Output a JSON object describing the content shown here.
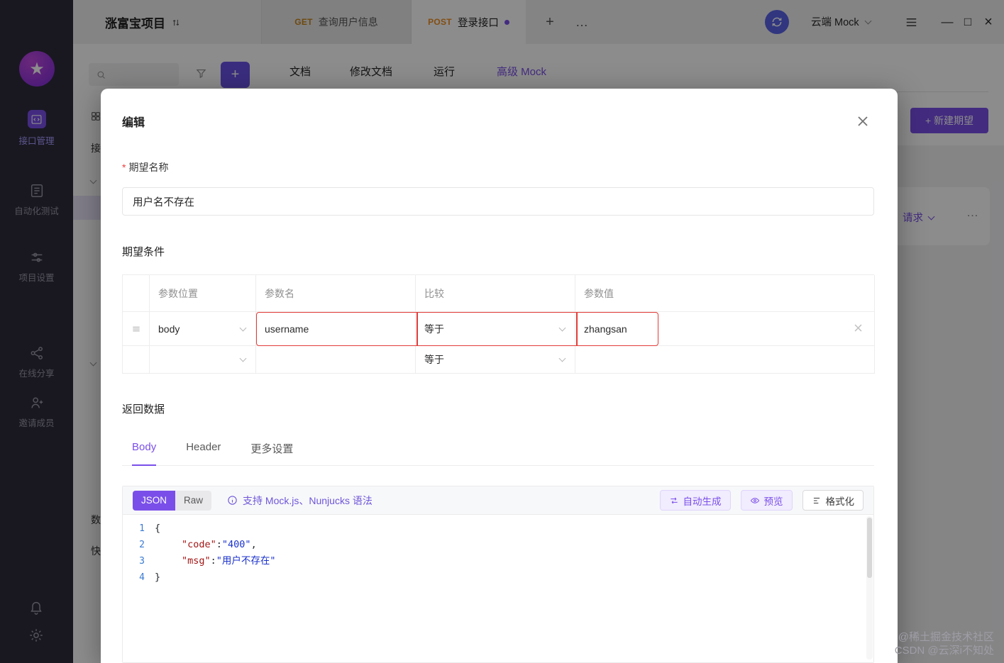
{
  "app": {
    "project_name": "涨富宝项目",
    "mock_env": "云端 Mock",
    "window_controls": {
      "minimize": "—",
      "maximize": "□",
      "close": "×"
    }
  },
  "sidebar": {
    "items": [
      {
        "label": "接口管理"
      },
      {
        "label": "自动化测试"
      },
      {
        "label": "项目设置"
      },
      {
        "label": "在线分享"
      },
      {
        "label": "邀请成员"
      }
    ]
  },
  "tabs": {
    "get_method": "GET",
    "get_label": "查询用户信息",
    "post_method": "POST",
    "post_label": "登录接口",
    "add": "+",
    "more": "…"
  },
  "toolbar": {
    "add_label": "+",
    "doc_tabs": [
      "文档",
      "修改文档",
      "运行",
      "高级 Mock"
    ]
  },
  "background": {
    "new_expectation": "+ 新建期望",
    "request": "请求",
    "more": "…",
    "tree_fragments": [
      "接",
      "数",
      "快"
    ]
  },
  "modal": {
    "title": "编辑",
    "required_mark": "*",
    "name_label": "期望名称",
    "name_value": "用户名不存在",
    "condition_title": "期望条件",
    "table": {
      "headers": [
        "参数位置",
        "参数名",
        "比较",
        "参数值"
      ],
      "row1": {
        "position": "body",
        "name": "username",
        "compare": "等于",
        "value": "zhangsan"
      },
      "row2": {
        "position": "",
        "name": "",
        "compare": "等于",
        "value": ""
      }
    },
    "return_title": "返回数据",
    "body_tabs": [
      "Body",
      "Header",
      "更多设置"
    ],
    "editor": {
      "mode_json": "JSON",
      "mode_raw": "Raw",
      "hint": "支持 Mock.js、Nunjucks 语法",
      "auto_generate": "自动生成",
      "preview": "预览",
      "format": "格式化",
      "line_numbers": [
        "1",
        "2",
        "3",
        "4"
      ],
      "code": {
        "l1": "{",
        "l2_key": "\"code\"",
        "l2_colon": ":",
        "l2_val": "\"400\"",
        "l2_comma": ",",
        "l3_key": "\"msg\"",
        "l3_colon": ":",
        "l3_val": "\"用户不存在\"",
        "l4": "}"
      }
    }
  },
  "watermark": {
    "line1": "@稀土掘金技术社区",
    "line2": "CSDN @云深i不知处"
  },
  "colors": {
    "accent": "#7a4fe9",
    "post_orange": "#ee8f22",
    "get_color": "#c8861a",
    "error_red": "#e23c39",
    "json_key": "#a31515",
    "json_value": "#1a31cc"
  }
}
